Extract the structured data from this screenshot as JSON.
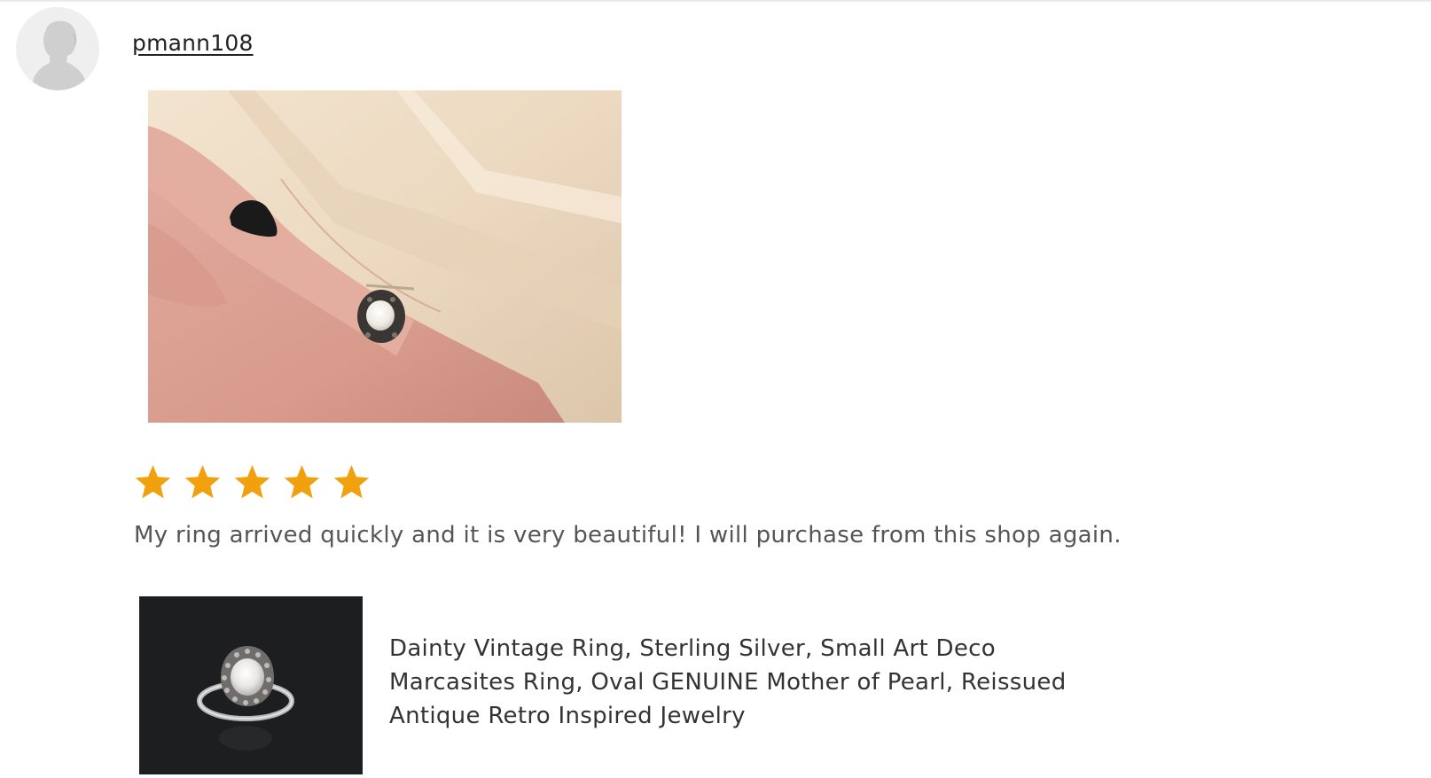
{
  "review": {
    "username": "pmann108",
    "rating": 5,
    "rating_max": 5,
    "text": "My ring arrived quickly and it is very beautiful! I will purchase from this shop again."
  },
  "product": {
    "title": "Dainty Vintage Ring, Sterling Silver, Small Art Deco Marcasites Ring, Oval GENUINE Mother of Pearl, Reissued Antique Retro Inspired Jewelry"
  },
  "icons": {
    "avatar": "default-user-silhouette-icon",
    "star": "star-icon"
  },
  "colors": {
    "star": "#f1a10d",
    "text_primary": "#222222",
    "text_review": "#555555",
    "thumb_background": "#1d1e20"
  }
}
